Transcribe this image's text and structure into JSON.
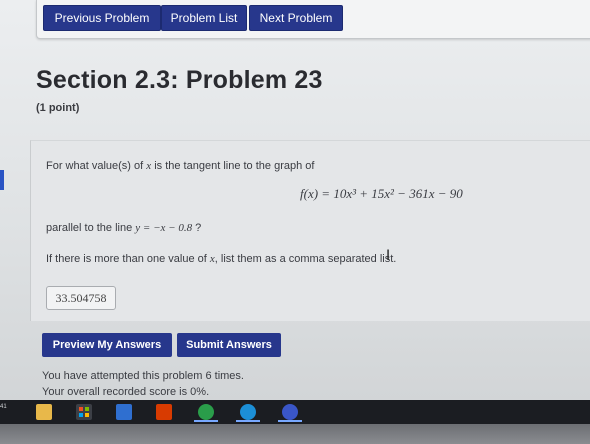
{
  "nav": {
    "previous": "Previous Problem",
    "list": "Problem List",
    "next": "Next Problem"
  },
  "problem": {
    "title": "Section 2.3: Problem 23",
    "points": "(1 point)",
    "q1a": "For what value(s) of ",
    "q1_var": "x",
    "q1b": " is the tangent line to the graph of",
    "equation": "f(x) = 10x³ + 15x² − 361x − 90",
    "q2a": "parallel to the line ",
    "q2_line": "y = −x − 0.8",
    "q2b": " ?",
    "q3a": "If there is more than one value of ",
    "q3_var": "x",
    "q3b": ", list them as a comma separated list."
  },
  "answer": {
    "value": "33.504758"
  },
  "actions": {
    "preview": "Preview My Answers",
    "submit": "Submit Answers"
  },
  "status": {
    "attempts": "You have attempted this problem 6 times.",
    "score": "Your overall recorded score is 0%."
  },
  "taskbar": {
    "clock": "41",
    "icons": [
      "explorer-icon",
      "store-icon",
      "mail-icon",
      "office-icon",
      "chrome-icon",
      "edge-icon",
      "chrome-profile-icon"
    ]
  },
  "colors": {
    "button": "#27378c",
    "page_bg": "#e4e6e8",
    "taskbar": "#1b1d22"
  }
}
